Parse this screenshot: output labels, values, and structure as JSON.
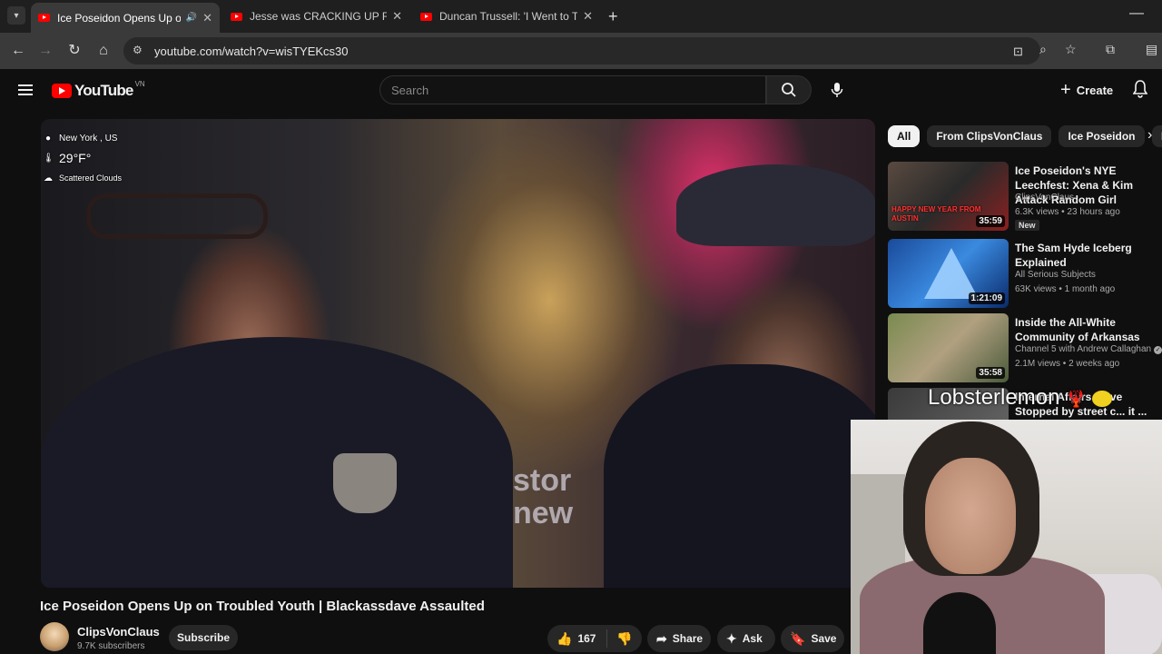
{
  "browser": {
    "tabs": [
      {
        "title": "Ice Poseidon Opens Up on",
        "active": true,
        "audio": true
      },
      {
        "title": "Jesse was CRACKING UP For RA",
        "active": false
      },
      {
        "title": "Duncan Trussell: 'I Went to The",
        "active": false
      }
    ],
    "url": "youtube.com/watch?v=wisTYEKcs30"
  },
  "yt": {
    "logo_text": "YouTube",
    "region": "VN",
    "search_placeholder": "Search",
    "create_label": "Create"
  },
  "video": {
    "overlay": {
      "location": "New York , US",
      "temperature": "29°F°",
      "conditions": "Scattered Clouds"
    },
    "title": "Ice Poseidon Opens Up on Troubled Youth | Blackassdave Assaulted",
    "channel": "ClipsVonClaus",
    "subscribers": "9.7K subscribers",
    "subscribe_label": "Subscribe",
    "likes": "167",
    "share_label": "Share",
    "ask_label": "Ask",
    "save_label": "Save"
  },
  "chips": [
    "All",
    "From ClipsVonClaus",
    "Ice Poseidon",
    "Re"
  ],
  "recommendations": [
    {
      "title": "Ice Poseidon's NYE Leechfest: Xena & Kim Attack Random Girl",
      "channel": "ClipsVonClaus",
      "stats": "6.3K views • 23 hours ago",
      "duration": "35:59",
      "badge": "New",
      "banner": "HAPPY NEW YEAR FROM AUSTIN"
    },
    {
      "title": "The Sam Hyde Iceberg Explained",
      "channel": "All Serious Subjects",
      "stats": "63K views • 1 month ago",
      "duration": "1:21:09"
    },
    {
      "title": "Inside the All-White Community of Arkansas",
      "channel": "Channel 5 with Andrew Callaghan",
      "stats": "2.1M views • 2 weeks ago",
      "duration": "35:58",
      "verified": true
    },
    {
      "title": "Internal Affairs d...ve Stopped by street c... it ...",
      "channel": "",
      "stats": ""
    }
  ],
  "webcam": {
    "overlay_name": "Lobsterlemon"
  }
}
